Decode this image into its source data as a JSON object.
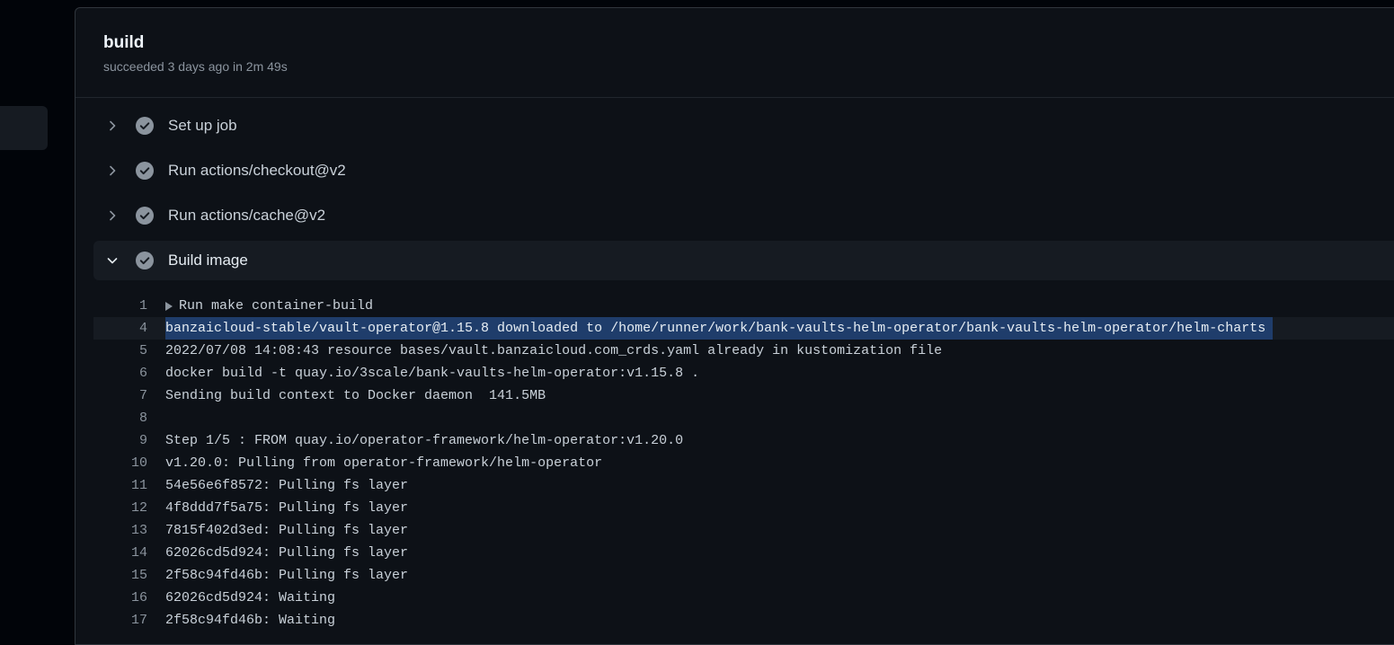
{
  "job": {
    "title": "build",
    "subtitle": "succeeded 3 days ago in 2m 49s"
  },
  "steps": [
    {
      "label": "Set up job",
      "expanded": false,
      "status": "success"
    },
    {
      "label": "Run actions/checkout@v2",
      "expanded": false,
      "status": "success"
    },
    {
      "label": "Run actions/cache@v2",
      "expanded": false,
      "status": "success"
    },
    {
      "label": "Build image",
      "expanded": true,
      "status": "success"
    }
  ],
  "log": [
    {
      "num": "1",
      "text": "Run make container-build",
      "group": true
    },
    {
      "num": "4",
      "text": "banzaicloud-stable/vault-operator@1.15.8 downloaded to /home/runner/work/bank-vaults-helm-operator/bank-vaults-helm-operator/helm-charts",
      "selected": true
    },
    {
      "num": "5",
      "text": "2022/07/08 14:08:43 resource bases/vault.banzaicloud.com_crds.yaml already in kustomization file"
    },
    {
      "num": "6",
      "text": "docker build -t quay.io/3scale/bank-vaults-helm-operator:v1.15.8 ."
    },
    {
      "num": "7",
      "text": "Sending build context to Docker daemon  141.5MB"
    },
    {
      "num": "8",
      "text": ""
    },
    {
      "num": "9",
      "text": "Step 1/5 : FROM quay.io/operator-framework/helm-operator:v1.20.0"
    },
    {
      "num": "10",
      "text": "v1.20.0: Pulling from operator-framework/helm-operator"
    },
    {
      "num": "11",
      "text": "54e56e6f8572: Pulling fs layer"
    },
    {
      "num": "12",
      "text": "4f8ddd7f5a75: Pulling fs layer"
    },
    {
      "num": "13",
      "text": "7815f402d3ed: Pulling fs layer"
    },
    {
      "num": "14",
      "text": "62026cd5d924: Pulling fs layer"
    },
    {
      "num": "15",
      "text": "2f58c94fd46b: Pulling fs layer"
    },
    {
      "num": "16",
      "text": "62026cd5d924: Waiting"
    },
    {
      "num": "17",
      "text": "2f58c94fd46b: Waiting"
    }
  ],
  "colors": {
    "background": "#0d1117",
    "selection": "#1f3d6b",
    "check": "#8b949e"
  }
}
